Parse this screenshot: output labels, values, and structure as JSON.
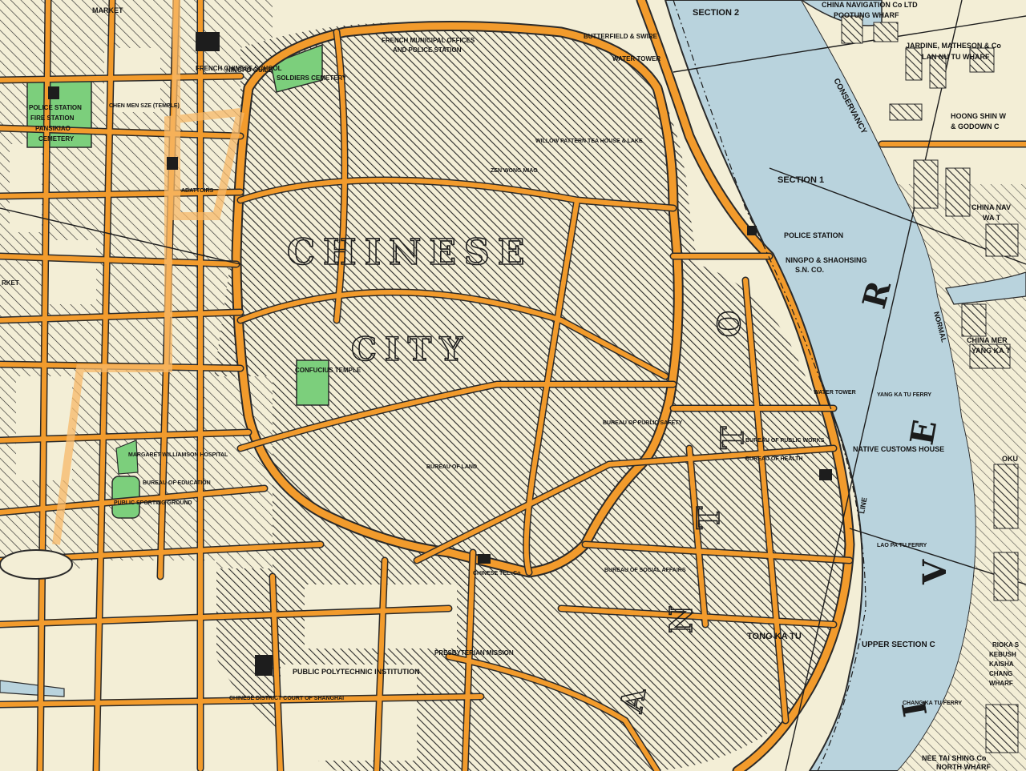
{
  "map": {
    "colors": {
      "paper": "#f3eed6",
      "road": "#f29b2c",
      "road_edge": "#2a2a2a",
      "river": "#b9d3dd",
      "river_edge": "#2a2a2a",
      "park": "#7ccf7c",
      "hatch": "#2a2a2a"
    },
    "district_labels": {
      "chinese": "CHINESE",
      "city": "CITY",
      "river_letter_r": "R",
      "river_letter_e": "E",
      "river_letter_v": "V",
      "river_letter_i": "I",
      "nantao_n": "N",
      "nantao_a": "A",
      "nantao_t": "T",
      "nantao_o": "O",
      "nantao_t2": "T"
    },
    "places": {
      "market": "MARKET",
      "police_fire": "POLICE STATION",
      "fire_station": "FIRE STATION",
      "pansikiao": "PANSIKIAO",
      "cemetery": "CEMETERY",
      "french_chinese_school": "FRENCH CHINESE SCHOOL",
      "ningpo_guild": "NINGPO GUILD",
      "soldiers_cemetery": "SOLDIERS CEMETERY",
      "french_municipal": "FRENCH MUNICIPAL OFFICES",
      "and_police": "AND POLICE STATION",
      "butterfield": "BUTTERFIELD & SWIRE",
      "water_tower_1": "WATER TOWER",
      "section_2": "SECTION 2",
      "section_1": "SECTION 1",
      "china_nav": "CHINA NAVIGATION Co LTD",
      "pootung_wharf": "POOTUNG WHARF",
      "jardine": "JARDINE, MATHESON & Co",
      "lan_nu_tu": "LAN NU TU WHARF",
      "hoong_shin": "HOONG SHIN W",
      "godown": "& GODOWN C",
      "china_nav_2": "CHINA NAV",
      "wa_t": "WA T",
      "conservancy": "CONSERVANCY",
      "chen_men_sze": "CHEN MEN SZE (TEMPLE)",
      "abattoirs": "ABATTOIRS",
      "willow_pattern": "WILLOW PATTERN TEA HOUSE & LAKE",
      "zen_wong": "ZEN WONG MIAO",
      "police_station_2": "POLICE STATION",
      "ningpo_shaohsing": "NINGPO & SHAOHSING",
      "sn_co": "S.N. CO.",
      "confucius": "CONFUCIUS TEMPLE",
      "water_tower_2": "WATER TOWER",
      "bureau_safety": "BUREAU OF PUBLIC SAFETY",
      "bureau_works": "BUREAU OF PUBLIC WORKS",
      "bureau_health": "BUREAU OF HEALTH",
      "native_customs": "NATIVE CUSTOMS HOUSE",
      "yang_ka_tu_ferry": "YANG KA TU FERRY",
      "china_mer": "CHINA MER",
      "yang_ka_t": "YANG KA T",
      "okura": "OKU",
      "normal": "NORMAL",
      "line": "LINE",
      "margaret": "MARGARET WILLIAMSON HOSPITAL",
      "bureau_education": "BUREAU OF EDUCATION",
      "public_sporting": "PUBLIC SPORTING GROUND",
      "bureau_land": "BUREAU OF LAND",
      "chinese_tel": "CHINESE TEL. Co",
      "lao_pa_tu": "LAO PA TU FERRY",
      "bureau_social": "BUREAU OF SOCIAL AFFAIRS",
      "tong_ka_tu": "TONG KA TU",
      "upper_section": "UPPER SECTION C",
      "polytechnic": "PUBLIC POLYTECHNIC INSTITUTION",
      "presbyterian": "PRESBYTERIAN MISSION",
      "chinese_court": "CHINESE DISTRICT COURT OF SHANGHAI",
      "chang_ka_tu": "CHANG KA TU FERRY",
      "rioka": "RIOKA S",
      "kebush": "KEBUSH",
      "kaisha": "KAISHA",
      "chang_wharf": "CHANG",
      "wharf_2": "WHARF",
      "nee_tai": "NEE TAI SHING Co",
      "north_wharf": "NORTH WHARF",
      "market_2": "RKET"
    }
  }
}
